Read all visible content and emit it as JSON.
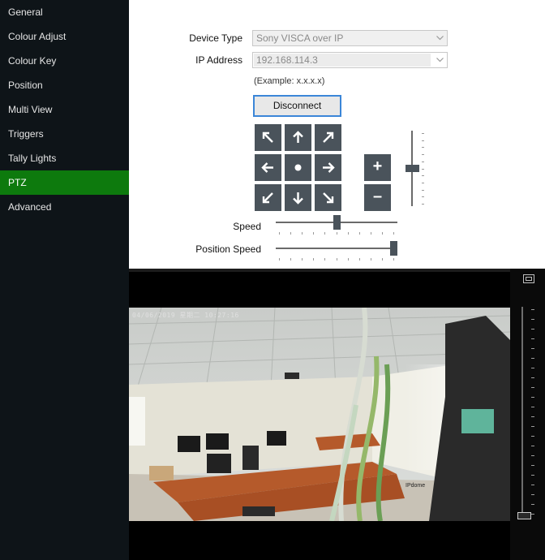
{
  "sidebar": {
    "items": [
      {
        "label": "General"
      },
      {
        "label": "Colour Adjust"
      },
      {
        "label": "Colour Key"
      },
      {
        "label": "Position"
      },
      {
        "label": "Multi View"
      },
      {
        "label": "Triggers"
      },
      {
        "label": "Tally Lights"
      },
      {
        "label": "PTZ",
        "active": true
      },
      {
        "label": "Advanced"
      }
    ]
  },
  "ptz": {
    "device_type_label": "Device Type",
    "device_type_value": "Sony VISCA over IP",
    "ip_label": "IP Address",
    "ip_value": "192.168.114.3",
    "ip_hint": "(Example: x.x.x.x)",
    "disconnect_label": "Disconnect",
    "zoom_in_symbol": "+",
    "zoom_out_symbol": "–",
    "speed_label": "Speed",
    "speed_value_fraction": 0.5,
    "position_speed_label": "Position Speed",
    "position_speed_value_fraction": 1.0,
    "zoom_slider_fraction": 0.5
  },
  "preview": {
    "camera_overlay_date": "04/06/2019 星期二 10:27:16",
    "camera_overlay_mark": "IPdome",
    "zoom_fraction": 0.0
  },
  "colors": {
    "sidebar_bg": "#0e1418",
    "active_item": "#0d7a0d",
    "button_bg": "#4a535b",
    "focus_border": "#3b86d8"
  },
  "icons": [
    "arrow-up-left-icon",
    "arrow-up-icon",
    "arrow-up-right-icon",
    "arrow-left-icon",
    "center-dot-icon",
    "arrow-right-icon",
    "arrow-down-left-icon",
    "arrow-down-icon",
    "arrow-down-right-icon",
    "fit-screen-icon",
    "chevron-down-icon"
  ]
}
